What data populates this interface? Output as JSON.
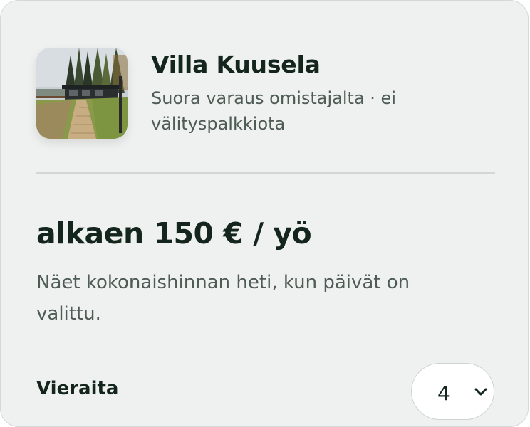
{
  "listing": {
    "name": "Villa Kuusela",
    "subtitle": "Suora varaus omistajalta · ei välityspalkkiota",
    "thumbnail_icon": "cabin-photo"
  },
  "pricing": {
    "price_text": "alkaen 150 € / yö",
    "note": "Näet kokonaishinnan heti, kun päivät on valittu."
  },
  "guests": {
    "label": "Vieraita",
    "selected": "4",
    "icon": "chevron-down-icon"
  }
}
